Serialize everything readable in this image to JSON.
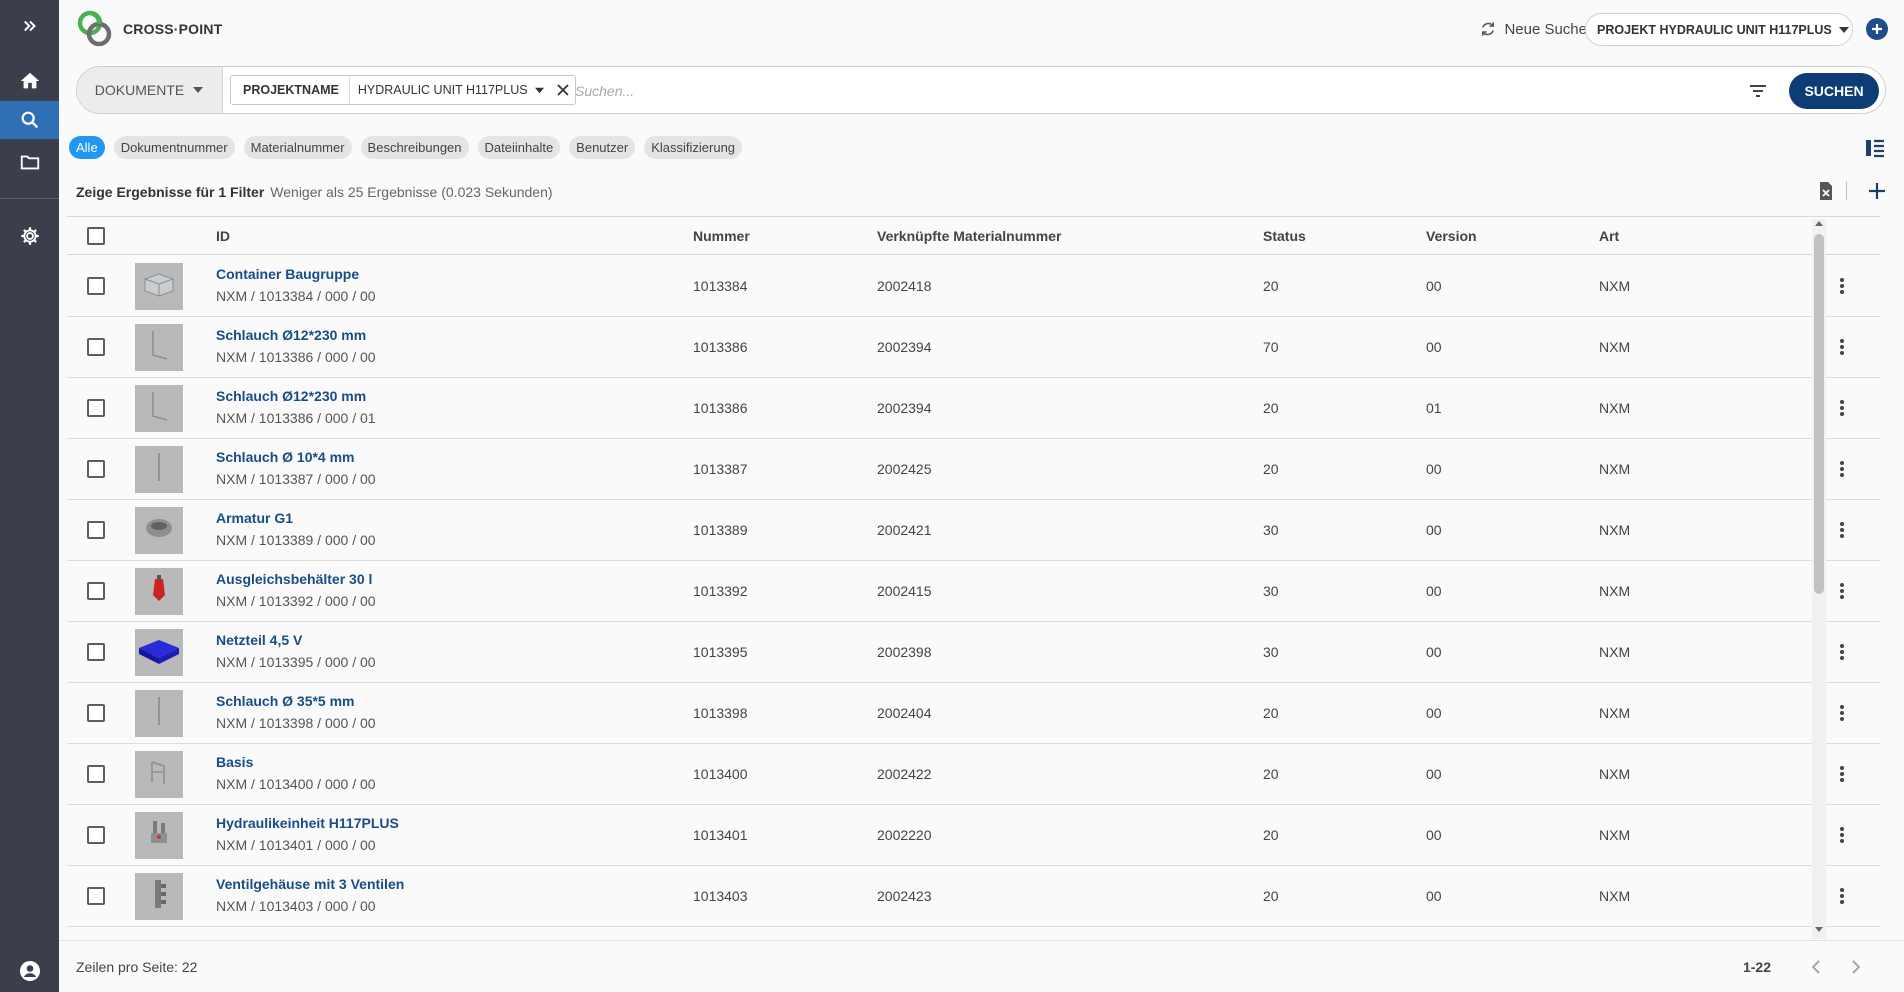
{
  "app": {
    "brand": "CROSS·POINT"
  },
  "header": {
    "new_search": "Neue Suche",
    "project_select": "PROJEKT HYDRAULIC UNIT H117PLUS"
  },
  "search": {
    "doc_type": "DOKUMENTE",
    "filter_key": "PROJEKTNAME",
    "filter_value": "HYDRAULIC UNIT H117PLUS",
    "placeholder": "Suchen...",
    "button": "SUCHEN"
  },
  "chips": [
    "Alle",
    "Dokumentnummer",
    "Materialnummer",
    "Beschreibungen",
    "Dateiinhalte",
    "Benutzer",
    "Klassifizierung"
  ],
  "summary": {
    "label": "Zeige Ergebnisse für 1 Filter",
    "detail": "Weniger als 25 Ergebnisse (0.023 Sekunden)"
  },
  "table": {
    "headers": {
      "id": "ID",
      "nummer": "Nummer",
      "material": "Verknüpfte Materialnummer",
      "status": "Status",
      "version": "Version",
      "art": "Art"
    },
    "rows": [
      {
        "title": "Container Baugruppe",
        "sub": "NXM / 1013384 / 000 / 00",
        "nummer": "1013384",
        "material": "2002418",
        "status": "20",
        "version": "00",
        "art": "NXM",
        "thumb": "container"
      },
      {
        "title": "Schlauch Ø12*230 mm",
        "sub": "NXM / 1013386 / 000 / 00",
        "nummer": "1013386",
        "material": "2002394",
        "status": "70",
        "version": "00",
        "art": "NXM",
        "thumb": "hose-bent"
      },
      {
        "title": "Schlauch Ø12*230 mm",
        "sub": "NXM / 1013386 / 000 / 01",
        "nummer": "1013386",
        "material": "2002394",
        "status": "20",
        "version": "01",
        "art": "NXM",
        "thumb": "hose-bent"
      },
      {
        "title": "Schlauch Ø 10*4 mm",
        "sub": "NXM / 1013387 / 000 / 00",
        "nummer": "1013387",
        "material": "2002425",
        "status": "20",
        "version": "00",
        "art": "NXM",
        "thumb": "hose-straight"
      },
      {
        "title": "Armatur G1",
        "sub": "NXM / 1013389 / 000 / 00",
        "nummer": "1013389",
        "material": "2002421",
        "status": "30",
        "version": "00",
        "art": "NXM",
        "thumb": "ring"
      },
      {
        "title": "Ausgleichsbehälter 30 l",
        "sub": "NXM / 1013392 / 000 / 00",
        "nummer": "1013392",
        "material": "2002415",
        "status": "30",
        "version": "00",
        "art": "NXM",
        "thumb": "tank"
      },
      {
        "title": "Netzteil 4,5 V",
        "sub": "NXM / 1013395 / 000 / 00",
        "nummer": "1013395",
        "material": "2002398",
        "status": "30",
        "version": "00",
        "art": "NXM",
        "thumb": "psu"
      },
      {
        "title": "Schlauch Ø 35*5 mm",
        "sub": "NXM / 1013398 / 000 / 00",
        "nummer": "1013398",
        "material": "2002404",
        "status": "20",
        "version": "00",
        "art": "NXM",
        "thumb": "hose-straight"
      },
      {
        "title": "Basis",
        "sub": "NXM / 1013400 / 000 / 00",
        "nummer": "1013400",
        "material": "2002422",
        "status": "20",
        "version": "00",
        "art": "NXM",
        "thumb": "frame"
      },
      {
        "title": "Hydraulikeinheit H117PLUS",
        "sub": "NXM / 1013401 / 000 / 00",
        "nummer": "1013401",
        "material": "2002220",
        "status": "20",
        "version": "00",
        "art": "NXM",
        "thumb": "unit"
      },
      {
        "title": "Ventilgehäuse mit 3 Ventilen",
        "sub": "NXM / 1013403 / 000 / 00",
        "nummer": "1013403",
        "material": "2002423",
        "status": "20",
        "version": "00",
        "art": "NXM",
        "thumb": "valve"
      }
    ]
  },
  "footer": {
    "rows_per_page": "Zeilen pro Seite: 22",
    "range": "1-22"
  },
  "colors": {
    "primary": "#0d3d74",
    "accent": "#2196f3",
    "link": "#1a4c86",
    "rail": "#3a3f4b"
  }
}
